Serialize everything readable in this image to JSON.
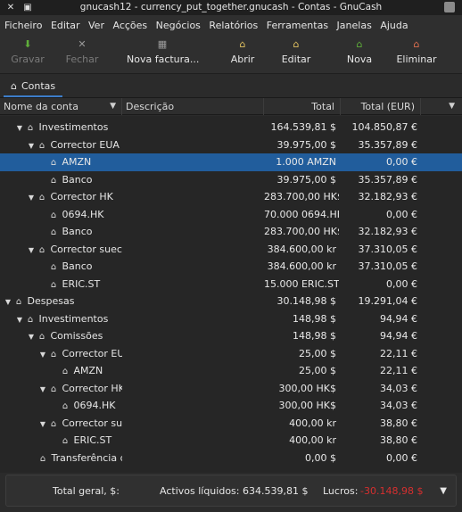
{
  "window": {
    "title": "gnucash12 - currency_put_together.gnucash - Contas - GnuCash"
  },
  "menu": [
    "Ficheiro",
    "Editar",
    "Ver",
    "Acções",
    "Negócios",
    "Relatórios",
    "Ferramentas",
    "Janelas",
    "Ajuda"
  ],
  "toolbar": {
    "save": "Gravar",
    "close": "Fechar",
    "new_invoice": "Nova factura...",
    "open": "Abrir",
    "edit": "Editar",
    "new": "Nova",
    "delete": "Eliminar"
  },
  "tab": {
    "label": "Contas"
  },
  "columns": {
    "name": "Nome da conta",
    "description": "Descrição",
    "total": "Total",
    "total_eur": "Total (EUR)"
  },
  "accounts": [
    {
      "name": "Investimentos",
      "total": "164.539,81 $",
      "total_eur": "104.850,87 €"
    },
    {
      "name": "Corrector EUA",
      "total": "39.975,00 $",
      "total_eur": "35.357,89 €"
    },
    {
      "name": "AMZN",
      "total": "1.000 AMZN",
      "total_eur": "0,00 €"
    },
    {
      "name": "Banco",
      "total": "39.975,00 $",
      "total_eur": "35.357,89 €"
    },
    {
      "name": "Corrector HK",
      "total": "283.700,00 HK$",
      "total_eur": "32.182,93 €"
    },
    {
      "name": "0694.HK",
      "total": "70.000 0694.HK",
      "total_eur": "0,00 €"
    },
    {
      "name": "Banco",
      "total": "283.700,00 HK$",
      "total_eur": "32.182,93 €"
    },
    {
      "name": "Corrector sueco",
      "total": "384.600,00 kr",
      "total_eur": "37.310,05 €"
    },
    {
      "name": "Banco",
      "total": "384.600,00 kr",
      "total_eur": "37.310,05 €"
    },
    {
      "name": "ERIC.ST",
      "total": "15.000 ERIC.ST",
      "total_eur": "0,00 €"
    },
    {
      "name": "Despesas",
      "total": "30.148,98 $",
      "total_eur": "19.291,04 €"
    },
    {
      "name": "Investimentos",
      "total": "148,98 $",
      "total_eur": "94,94 €"
    },
    {
      "name": "Comissões",
      "total": "148,98 $",
      "total_eur": "94,94 €"
    },
    {
      "name": "Corrector EUA",
      "total": "25,00 $",
      "total_eur": "22,11 €"
    },
    {
      "name": "AMZN",
      "total": "25,00 $",
      "total_eur": "22,11 €"
    },
    {
      "name": "Corrector HK",
      "total": "300,00 HK$",
      "total_eur": "34,03 €"
    },
    {
      "name": "0694.HK",
      "total": "300,00 HK$",
      "total_eur": "34,03 €"
    },
    {
      "name": "Corrector sue",
      "total": "400,00 kr",
      "total_eur": "38,80 €"
    },
    {
      "name": "ERIC.ST",
      "total": "400,00 kr",
      "total_eur": "38,80 €"
    },
    {
      "name": "Transferência de",
      "total": "0,00 $",
      "total_eur": "0,00 €"
    }
  ],
  "footer": {
    "grand_total": "Total geral, $:",
    "net_assets": "Activos líquidos: 634.539,81 $",
    "profit_label": "Lucros:",
    "profit_value": "-30.148,98 $"
  },
  "colors": {
    "selection": "#215d9c",
    "negative": "#d62f2f"
  }
}
